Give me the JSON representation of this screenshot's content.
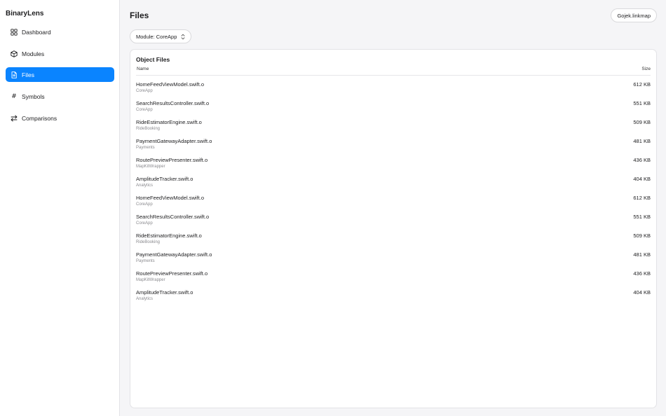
{
  "app": {
    "title": "BinaryLens"
  },
  "sidebar": {
    "items": [
      {
        "label": "Dashboard",
        "icon": "grid-icon",
        "active": false
      },
      {
        "label": "Modules",
        "icon": "cube-icon",
        "active": false
      },
      {
        "label": "Files",
        "icon": "document-icon",
        "active": true
      },
      {
        "label": "Symbols",
        "icon": "hash-icon",
        "active": false
      },
      {
        "label": "Comparisons",
        "icon": "swap-arrows-icon",
        "active": false
      }
    ]
  },
  "header": {
    "title": "Files",
    "project_label": "Gojek.linkmap"
  },
  "filter": {
    "module_label": "Module: CoreApp"
  },
  "panel": {
    "title": "Object Files",
    "columns": {
      "name": "Name",
      "size": "Size"
    },
    "rows": [
      {
        "name": "HomeFeedViewModel.swift.o",
        "module": "CoreApp",
        "size": "612 KB"
      },
      {
        "name": "SearchResultsController.swift.o",
        "module": "CoreApp",
        "size": "551 KB"
      },
      {
        "name": "RideEstimatorEngine.swift.o",
        "module": "RideBooking",
        "size": "509 KB"
      },
      {
        "name": "PaymentGatewayAdapter.swift.o",
        "module": "Payments",
        "size": "481 KB"
      },
      {
        "name": "RoutePreviewPresenter.swift.o",
        "module": "MapKitWrapper",
        "size": "436 KB"
      },
      {
        "name": "AmplitudeTracker.swift.o",
        "module": "Analytics",
        "size": "404 KB"
      },
      {
        "name": "HomeFeedViewModel.swift.o",
        "module": "CoreApp",
        "size": "612 KB"
      },
      {
        "name": "SearchResultsController.swift.o",
        "module": "CoreApp",
        "size": "551 KB"
      },
      {
        "name": "RideEstimatorEngine.swift.o",
        "module": "RideBooking",
        "size": "509 KB"
      },
      {
        "name": "PaymentGatewayAdapter.swift.o",
        "module": "Payments",
        "size": "481 KB"
      },
      {
        "name": "RoutePreviewPresenter.swift.o",
        "module": "MapKitWrapper",
        "size": "436 KB"
      },
      {
        "name": "AmplitudeTracker.swift.o",
        "module": "Analytics",
        "size": "404 KB"
      }
    ]
  },
  "colors": {
    "accent": "#0a84ff",
    "background": "#f5f5f7",
    "secondary_text": "#8a8a8e"
  }
}
